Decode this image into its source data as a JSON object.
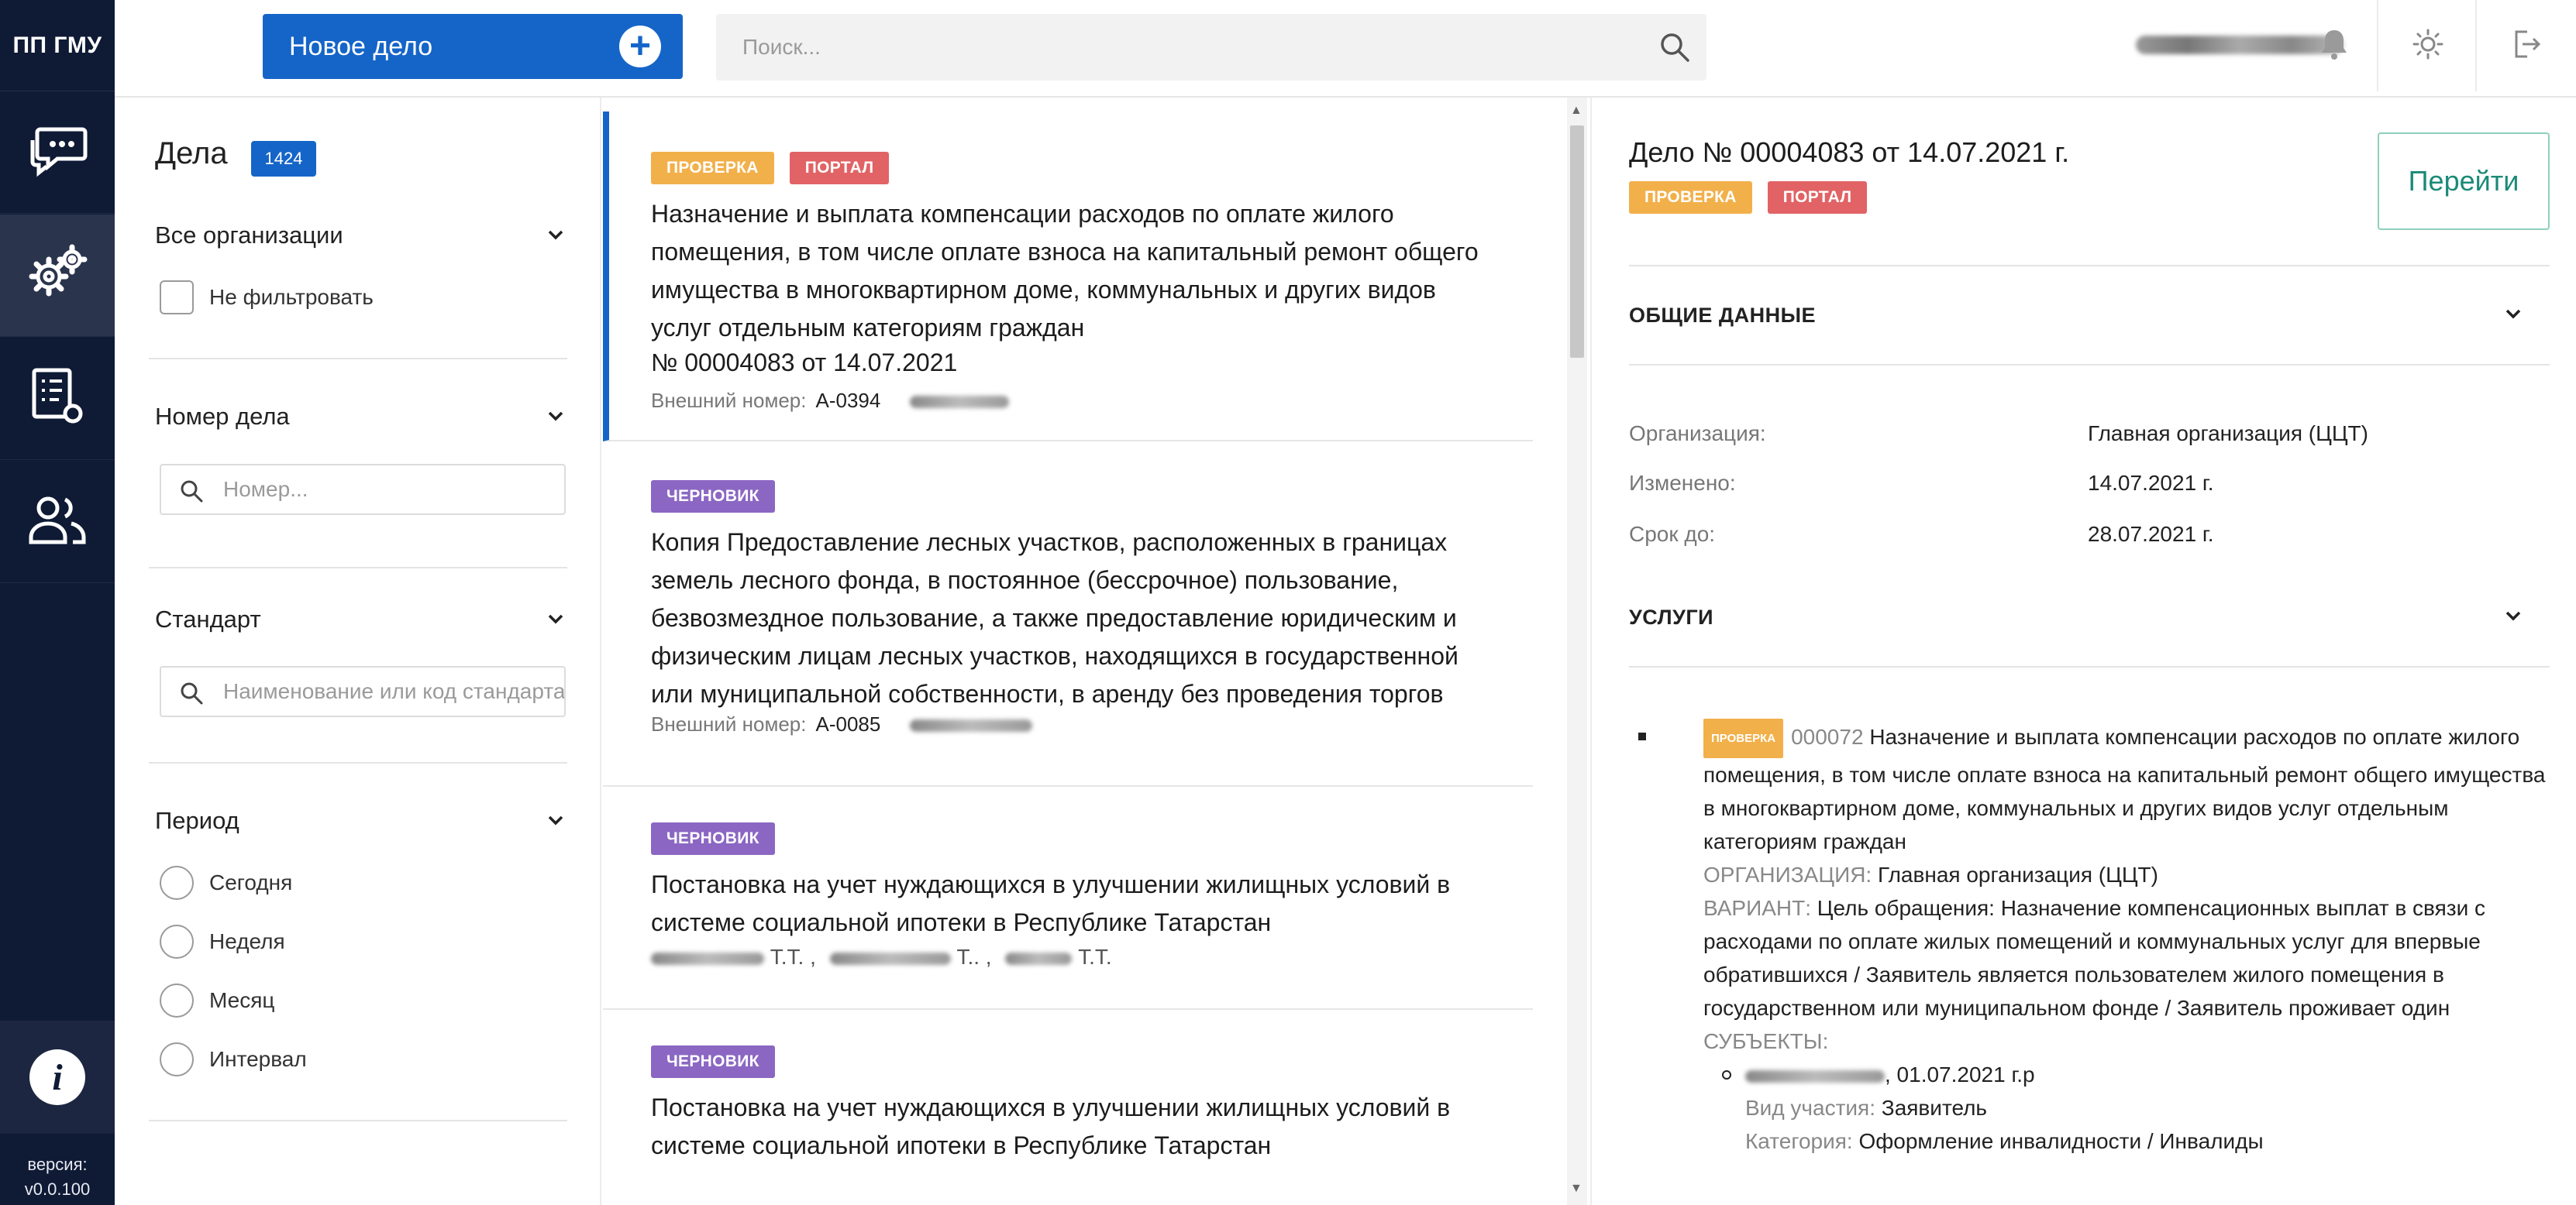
{
  "app": {
    "name": "ПП ГМУ",
    "version_label": "версия:",
    "version": "v0.0.100"
  },
  "nav": {
    "items": [
      {
        "name": "chat-icon",
        "active": false
      },
      {
        "name": "settings-gears-icon",
        "active": true
      },
      {
        "name": "documents-icon",
        "active": false
      },
      {
        "name": "users-icon",
        "active": false
      }
    ],
    "info_symbol": "i"
  },
  "topbar": {
    "new_case_label": "Новое дело",
    "new_case_icon": "plus-circle-icon",
    "search_placeholder": "Поиск...",
    "icons": [
      "bell-icon",
      "sun-icon",
      "logout-icon"
    ]
  },
  "filters": {
    "title": "Дела",
    "count": "1424",
    "orgs": {
      "label": "Все организации",
      "checkbox_label": "Не фильтровать"
    },
    "case_number": {
      "label": "Номер дела",
      "placeholder": "Номер..."
    },
    "standard": {
      "label": "Стандарт",
      "placeholder": "Наименование или код стандарта"
    },
    "period": {
      "label": "Период",
      "options": [
        "Сегодня",
        "Неделя",
        "Месяц",
        "Интервал"
      ]
    }
  },
  "cases": [
    {
      "badges": [
        "ПРОВЕРКА",
        "ПОРТАЛ"
      ],
      "title_lines": [
        "Назначение и выплата компенсации расходов по оплате жилого",
        "помещения, в том числе оплате взноса на капитальный ремонт общего",
        "имущества в многоквартирном доме, коммунальных и других видов",
        "услуг отдельным категориям граждан"
      ],
      "number": "№ 00004083 от 14.07.2021",
      "ext_label": "Внешний номер:",
      "ext_value": "А-0394"
    },
    {
      "badges": [
        "ЧЕРНОВИК"
      ],
      "title_lines": [
        "Копия Предоставление лесных участков, расположенных в границах",
        "земель лесного фонда, в постоянное (бессрочное) пользование,",
        "безвозмездное пользование, а также предоставление юридическим и",
        "физическим лицам лесных участков, находящихся в государственной",
        "или муниципальной собственности, в аренду без проведения торгов"
      ],
      "ext_label": "Внешний номер:",
      "ext_value": "А-0085"
    },
    {
      "badges": [
        "ЧЕРНОВИК"
      ],
      "title_lines": [
        "Постановка на учет нуждающихся в улучшении жилищных условий в",
        "системе социальной ипотеки в Республике Татарстан"
      ],
      "people": [
        "Т.Т. ,",
        "Т.. ,",
        "Т.Т."
      ]
    },
    {
      "badges": [
        "ЧЕРНОВИК"
      ],
      "title_lines": [
        "Постановка на учет нуждающихся в улучшении жилищных условий в",
        "системе социальной ипотеки в Республике Татарстан"
      ]
    }
  ],
  "detail": {
    "title": "Дело № 00004083 от 14.07.2021 г.",
    "badges": [
      "ПРОВЕРКА",
      "ПОРТАЛ"
    ],
    "go_label": "Перейти",
    "general_section": "ОБЩИЕ ДАННЫЕ",
    "fields": [
      {
        "label": "Организация:",
        "value": "Главная организация (ЦЦТ)"
      },
      {
        "label": "Изменено:",
        "value": "14.07.2021 г."
      },
      {
        "label": "Срок до:",
        "value": "28.07.2021 г."
      }
    ],
    "services_section": "УСЛУГИ",
    "service": {
      "badge": "ПРОВЕРКА",
      "code": "000072",
      "title": "Назначение и выплата компенсации расходов по оплате жилого помещения, в том числе оплате взноса на капитальный ремонт общего имущества в многоквартирном доме, коммунальных и других видов услуг отдельным категориям граждан",
      "org_label": "ОРГАНИЗАЦИЯ:",
      "org_value": "Главная организация (ЦЦТ)",
      "variant_label": "ВАРИАНТ:",
      "variant_value": "Цель обращения: Назначение компенсационных выплат в связи с расходами по оплате жилых помещений и коммунальных услуг для впервые обратившихся / Заявитель является пользователем жилого помещения в государственном или муниципальном фонде / Заявитель проживает один",
      "subjects_label": "СУБЪЕКТЫ:",
      "subject_date": ", 01.07.2021 г.р",
      "role_label": "Вид участия:",
      "role_value": "Заявитель",
      "category_label": "Категория:",
      "category_value": "Оформление инвалидности / Инвалиды"
    }
  },
  "colors": {
    "nav_bg": "#0f1a35",
    "accent": "#1565c8",
    "check": "#f2b04a",
    "portal": "#e16365",
    "draft": "#8b67c3",
    "go": "#1b8a78"
  }
}
